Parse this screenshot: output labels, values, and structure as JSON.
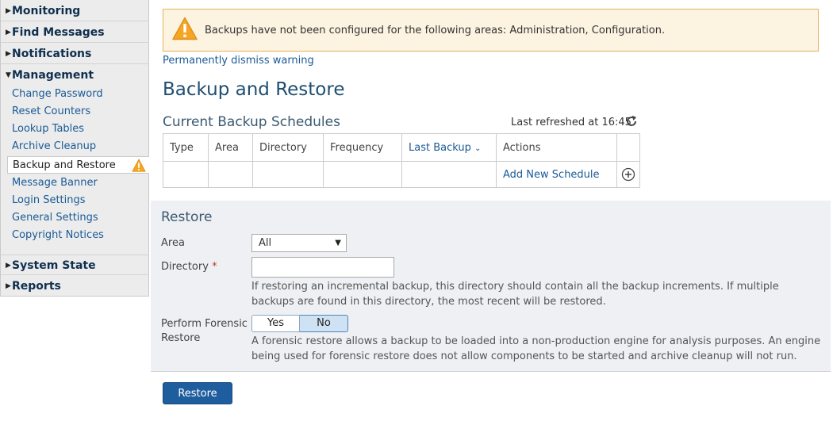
{
  "sidebar": {
    "sections": {
      "monitoring": "Monitoring",
      "find_messages": "Find Messages",
      "notifications": "Notifications",
      "management": "Management",
      "system_state": "System State",
      "reports": "Reports"
    },
    "management_items": [
      "Change Password",
      "Reset Counters",
      "Lookup Tables",
      "Archive Cleanup",
      "Backup and Restore",
      "Message Banner",
      "Login Settings",
      "General Settings",
      "Copyright Notices"
    ],
    "active_item": "Backup and Restore"
  },
  "warning": {
    "message": "Backups have not been configured for the following areas: Administration, Configuration.",
    "dismiss_link": "Permanently dismiss warning"
  },
  "page_title": "Backup and Restore",
  "schedules": {
    "title": "Current Backup Schedules",
    "last_refreshed": "Last refreshed at 16:45",
    "columns": [
      "Type",
      "Area",
      "Directory",
      "Frequency",
      "Last Backup",
      "Actions"
    ],
    "add_link": "Add New Schedule"
  },
  "restore": {
    "title": "Restore",
    "area_label": "Area",
    "area_value": "All",
    "directory_label": "Directory",
    "required_mark": "*",
    "directory_value": "",
    "directory_help": "If restoring an incremental backup, this directory should contain all the backup increments. If multiple backups are found in this directory, the most recent will be restored.",
    "forensic_label_line1": "Perform Forensic",
    "forensic_label_line2": "Restore",
    "toggle_yes": "Yes",
    "toggle_no": "No",
    "toggle_selected": "No",
    "forensic_help": "A forensic restore allows a backup to be loaded into a non-production engine for analysis purposes. An engine being used for forensic restore does not allow components to be started and archive cleanup will not run.",
    "button": "Restore"
  },
  "colors": {
    "link": "#1a5a96",
    "primary_button": "#1f5e9e",
    "warning_bg": "#fcf3e0",
    "warning_icon": "#f5a623"
  }
}
